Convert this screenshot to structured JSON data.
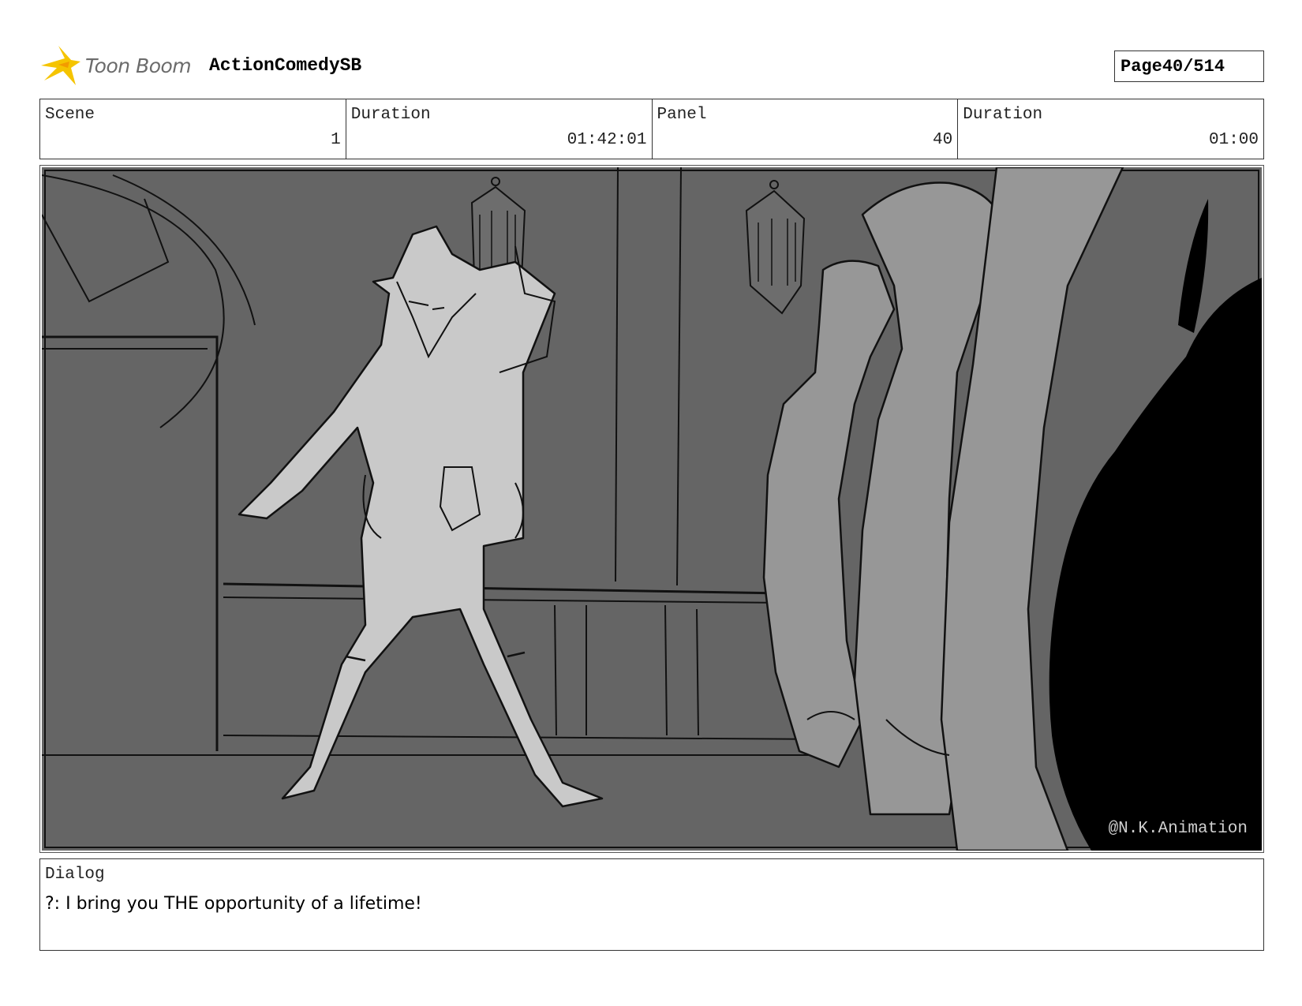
{
  "header": {
    "logo_text": "Toon Boom",
    "project_title": "ActionComedySB",
    "page_label": "Page",
    "page_value": "40/514"
  },
  "info": {
    "scene_label": "Scene",
    "scene_value": "1",
    "scene_duration_label": "Duration",
    "scene_duration_value": "01:42:01",
    "panel_label": "Panel",
    "panel_value": "40",
    "panel_duration_label": "Duration",
    "panel_duration_value": "01:00"
  },
  "panel": {
    "watermark": "@N.K.Animation"
  },
  "dialog": {
    "label": "Dialog",
    "text": "?: I bring you THE opportunity of a lifetime!"
  },
  "colors": {
    "logo_accent": "#f5c400",
    "panel_background": "#656565",
    "sketch_light": "#c9c9c9",
    "sketch_mid": "#979797",
    "silhouette": "#000000"
  }
}
